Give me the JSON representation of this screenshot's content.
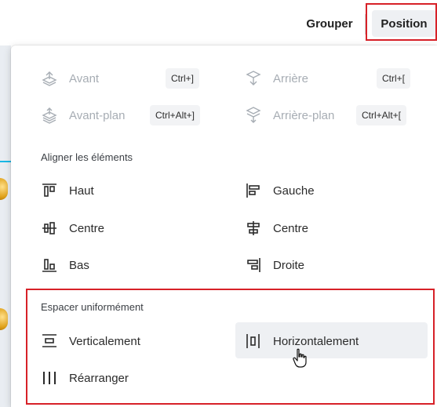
{
  "toolbar": {
    "group_label": "Grouper",
    "position_label": "Position"
  },
  "menu": {
    "layers": [
      {
        "label": "Avant",
        "shortcut": "Ctrl+]",
        "icon": "bring-forward-icon"
      },
      {
        "label": "Arrière",
        "shortcut": "Ctrl+[",
        "icon": "send-backward-icon"
      },
      {
        "label": "Avant-plan",
        "shortcut": "Ctrl+Alt+]",
        "icon": "bring-to-front-icon"
      },
      {
        "label": "Arrière-plan",
        "shortcut": "Ctrl+Alt+[",
        "icon": "send-to-back-icon"
      }
    ],
    "align_heading": "Aligner les éléments",
    "align": {
      "top": "Haut",
      "left": "Gauche",
      "middle": "Centre",
      "center": "Centre",
      "bottom": "Bas",
      "right": "Droite"
    },
    "spacing_heading": "Espacer uniformément",
    "spacing": {
      "vertical": "Verticalement",
      "horizontal": "Horizontalement",
      "tidy": "Réarranger"
    }
  },
  "colors": {
    "highlight_border": "#d72128",
    "disabled_text": "#a7adb4",
    "hover_bg": "#eef0f3"
  }
}
